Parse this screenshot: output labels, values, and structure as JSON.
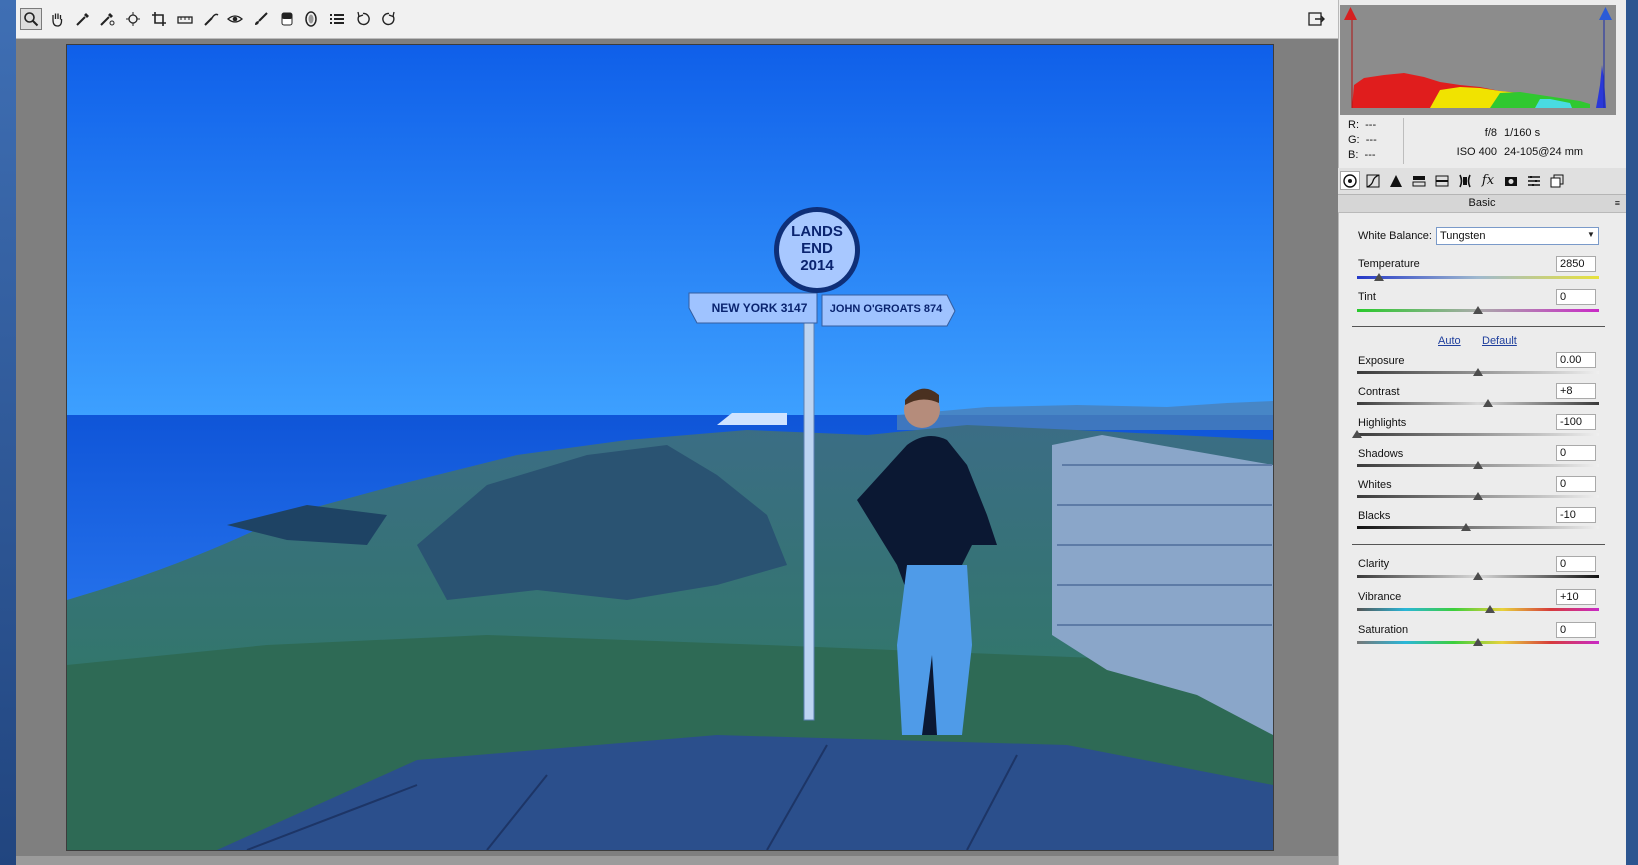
{
  "toolbar": {
    "tools": [
      "zoom-icon",
      "hand-icon",
      "white-balance-icon",
      "color-sampler-icon",
      "target-adjustment-icon",
      "crop-icon",
      "straighten-icon",
      "spot-removal-icon",
      "red-eye-icon",
      "adjustment-brush-icon",
      "graduated-filter-icon",
      "radial-filter-icon",
      "list-icon",
      "rotate-left-icon",
      "rotate-right-icon"
    ],
    "open_preferences_icon": "export-icon"
  },
  "photo": {
    "sign_line1": "LANDS",
    "sign_line2": "END",
    "sign_line3": "2014",
    "arm_left": "NEW YORK 3147",
    "arm_right": "JOHN O'GROATS 874"
  },
  "info": {
    "r_label": "R:",
    "r_value": "---",
    "g_label": "G:",
    "g_value": "---",
    "b_label": "B:",
    "b_value": "---",
    "aperture": "f/8",
    "shutter": "1/160 s",
    "iso": "ISO 400",
    "lens": "24-105@24 mm"
  },
  "panel": {
    "section_title": "Basic",
    "white_balance_label": "White Balance:",
    "white_balance_value": "Tungsten",
    "auto_link": "Auto",
    "default_link": "Default",
    "sliders": [
      {
        "name": "temperature",
        "label": "Temperature",
        "value": "2850",
        "pos": 0.09
      },
      {
        "name": "tint",
        "label": "Tint",
        "value": "0",
        "pos": 0.5
      },
      {
        "name": "exposure",
        "label": "Exposure",
        "value": "0.00",
        "pos": 0.5
      },
      {
        "name": "contrast",
        "label": "Contrast",
        "value": "+8",
        "pos": 0.54
      },
      {
        "name": "highlights",
        "label": "Highlights",
        "value": "-100",
        "pos": 0.0
      },
      {
        "name": "shadows",
        "label": "Shadows",
        "value": "0",
        "pos": 0.5
      },
      {
        "name": "whites",
        "label": "Whites",
        "value": "0",
        "pos": 0.5
      },
      {
        "name": "blacks",
        "label": "Blacks",
        "value": "-10",
        "pos": 0.45
      },
      {
        "name": "clarity",
        "label": "Clarity",
        "value": "0",
        "pos": 0.5
      },
      {
        "name": "vibrance",
        "label": "Vibrance",
        "value": "+10",
        "pos": 0.55
      },
      {
        "name": "saturation",
        "label": "Saturation",
        "value": "0",
        "pos": 0.5
      }
    ]
  },
  "colors": {
    "accent": "#1f3f9d",
    "clip_shadow": "#d62020",
    "clip_highlight": "#2a5bd8"
  }
}
